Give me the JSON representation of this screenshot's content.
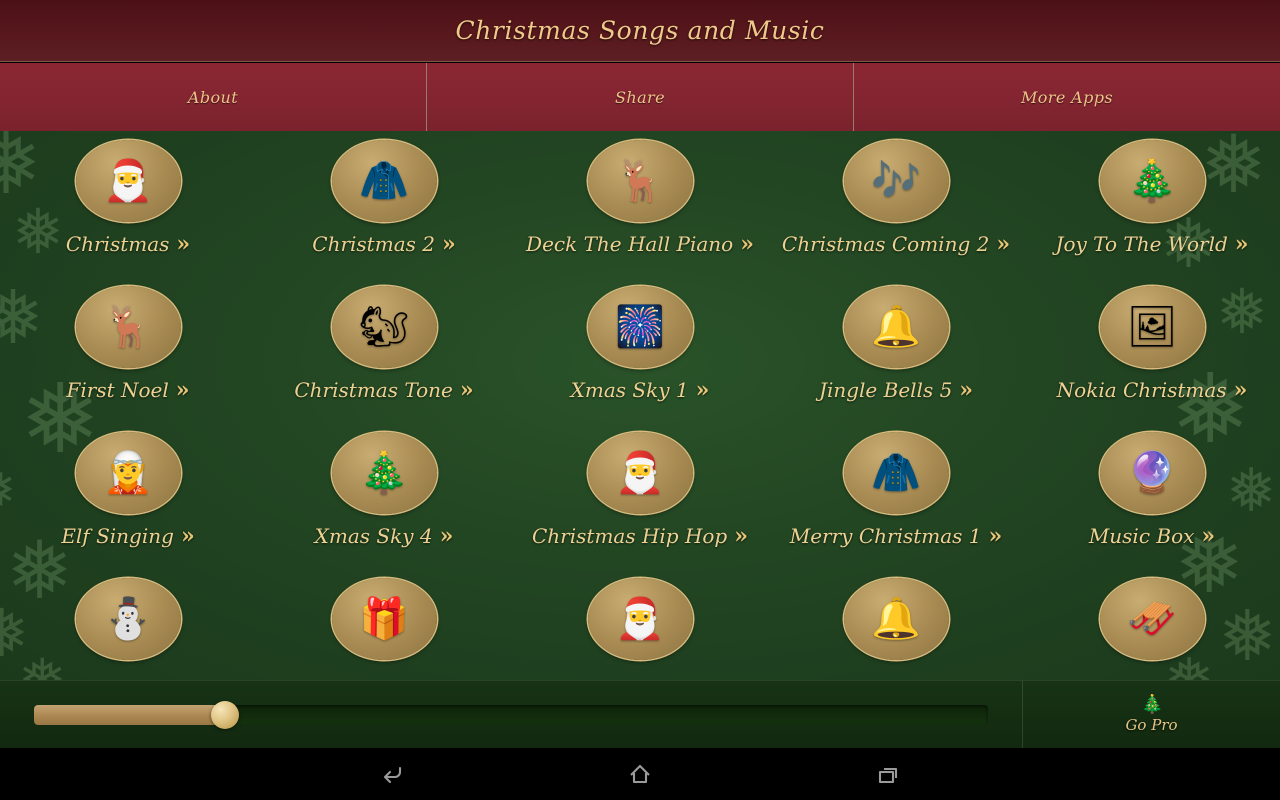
{
  "app": {
    "title": "Christmas Songs and Music"
  },
  "menu": {
    "items": [
      {
        "label": "About",
        "name": "menu-item-about"
      },
      {
        "label": "Share",
        "name": "menu-item-share"
      },
      {
        "label": "More Apps",
        "name": "menu-item-more-apps"
      }
    ]
  },
  "songs": [
    {
      "label": "Christmas",
      "art": "🎅",
      "arrow": "»"
    },
    {
      "label": "Christmas 2",
      "art": "🧥",
      "arrow": "»"
    },
    {
      "label": "Deck The Hall Piano",
      "art": "🦌",
      "arrow": "»"
    },
    {
      "label": "Christmas Coming 2",
      "art": "🎶",
      "arrow": "»"
    },
    {
      "label": "Joy To The World",
      "art": "🎄",
      "arrow": "»"
    },
    {
      "label": "First Noel",
      "art": "🦌",
      "arrow": "»"
    },
    {
      "label": "Christmas Tone",
      "art": "🐿",
      "arrow": "»"
    },
    {
      "label": "Xmas Sky 1",
      "art": "🎆",
      "arrow": "»"
    },
    {
      "label": "Jingle Bells 5",
      "art": "🔔",
      "arrow": "»"
    },
    {
      "label": "Nokia Christmas",
      "art": "🖼",
      "arrow": "»"
    },
    {
      "label": "Elf Singing",
      "art": "🧝",
      "arrow": "»"
    },
    {
      "label": "Xmas Sky 4",
      "art": "🎄",
      "arrow": "»"
    },
    {
      "label": "Christmas Hip Hop",
      "art": "🎅",
      "arrow": "»"
    },
    {
      "label": "Merry Christmas 1",
      "art": "🧥",
      "arrow": "»"
    },
    {
      "label": "Music Box",
      "art": "🔮",
      "arrow": "»"
    },
    {
      "label": "",
      "art": "⛄",
      "arrow": ""
    },
    {
      "label": "",
      "art": "🎁",
      "arrow": ""
    },
    {
      "label": "",
      "art": "🎅",
      "arrow": ""
    },
    {
      "label": "",
      "art": "🔔",
      "arrow": ""
    },
    {
      "label": "",
      "art": "🛷",
      "arrow": ""
    }
  ],
  "player": {
    "seek_percent": 20,
    "gopro_label": "Go Pro",
    "gopro_icon": "🎄"
  },
  "navbar": {
    "back_label": "Back",
    "home_label": "Home",
    "recents_label": "Recent apps"
  },
  "colors": {
    "title_bar": "#4b1016",
    "menu_bar": "#8b2632",
    "gold_text": "#edd193",
    "background_green": "#224522",
    "thumb_gold": "#ab8e55",
    "seek_fill": "#a9854f"
  }
}
